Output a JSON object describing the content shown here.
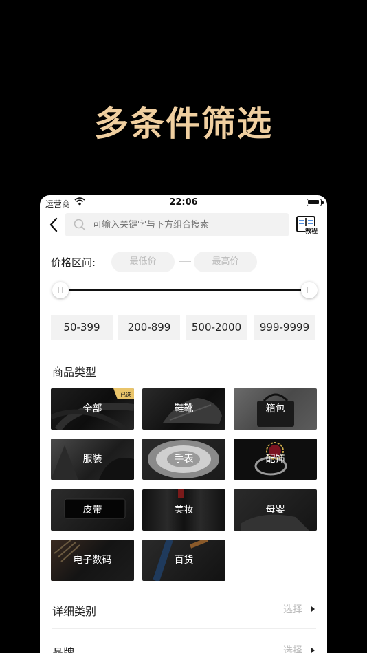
{
  "promo": {
    "title": "多条件筛选"
  },
  "status_bar": {
    "carrier": "运营商",
    "time": "22:06"
  },
  "nav": {
    "search_placeholder": "可输入关键字与下方组合搜索",
    "tutorial_label": "教程"
  },
  "price": {
    "label": "价格区间:",
    "min_placeholder": "最低价",
    "max_placeholder": "最高价",
    "presets": [
      "50-399",
      "200-899",
      "500-2000",
      "999-9999"
    ]
  },
  "category": {
    "title": "商品类型",
    "selected_badge": "已选",
    "items": [
      "全部",
      "鞋靴",
      "箱包",
      "服装",
      "手表",
      "配饰",
      "皮带",
      "美妆",
      "母婴",
      "电子数码",
      "百货"
    ]
  },
  "details": [
    {
      "label": "详细类别",
      "value": "选择"
    },
    {
      "label": "品牌",
      "value": "选择"
    }
  ],
  "colors": {
    "promo_gold": "#f0cfa0",
    "badge_gold": "#e9c46a",
    "accent_dark": "#111111"
  }
}
